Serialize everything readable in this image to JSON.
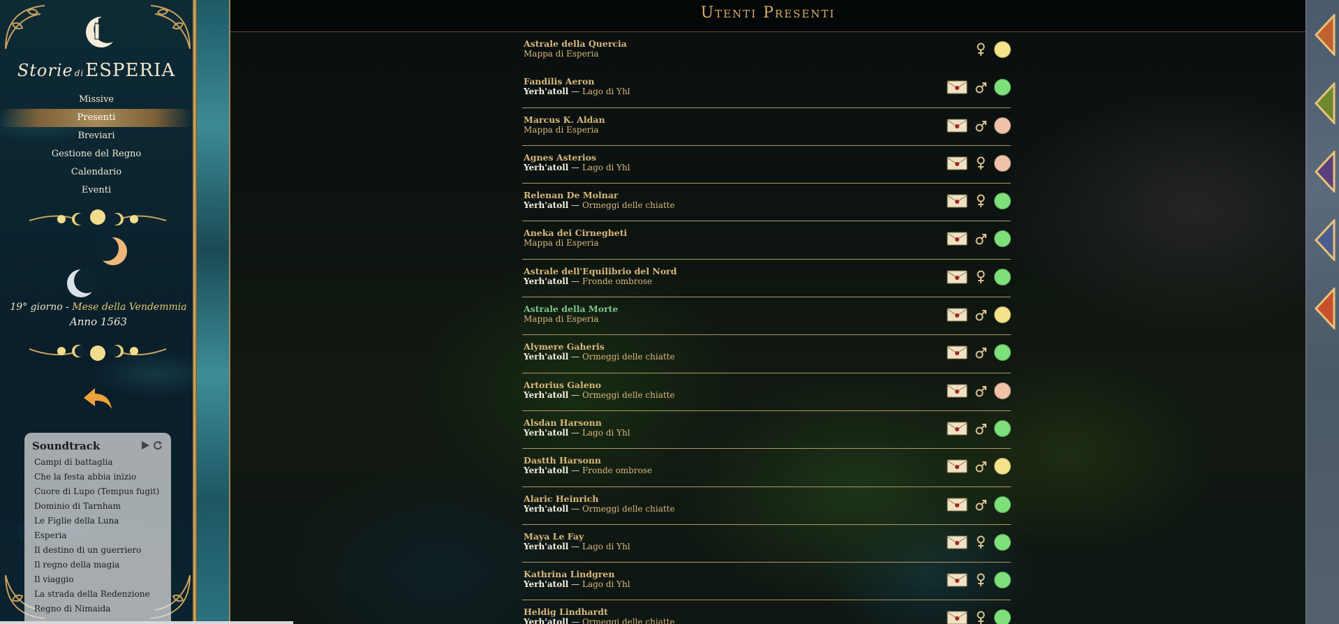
{
  "sidebar": {
    "title_prefix": "Storie",
    "title_di": "di",
    "title_main": "ESPERIA",
    "menu": [
      {
        "label": "Missive",
        "active": false
      },
      {
        "label": "Presenti",
        "active": true
      },
      {
        "label": "Breviari",
        "active": false
      },
      {
        "label": "Gestione del Regno",
        "active": false
      },
      {
        "label": "Calendario",
        "active": false
      },
      {
        "label": "Eventi",
        "active": false
      }
    ],
    "date_day": "19° giorno - ",
    "date_month": "Mese della Vendemmia",
    "date_year": "Anno 1563",
    "soundtrack": {
      "title": "Soundtrack",
      "tracks": [
        "Campi di battaglia",
        "Che la festa abbia inizio",
        "Cuore di Lupo (Tempus fugit)",
        "Dominio di Tarnham",
        "Le Figlie della Luna",
        "Esperia",
        "Il destino di un guerriero",
        "Il regno della magia",
        "Il viaggio",
        "La strada della Redenzione",
        "Regno di Nimaida"
      ]
    }
  },
  "main": {
    "title": "Utenti Presenti",
    "users": [
      {
        "name": "Astrale della Quercia",
        "region": "",
        "place": "Mappa di Esperia",
        "mail": false,
        "gender": "female",
        "status": "#f3e38a",
        "name_color": "gold"
      },
      {
        "name": "Fandilis Aeron",
        "region": "Yerh'atoll",
        "place": "Lago di Yhl",
        "mail": true,
        "gender": "male",
        "status": "#7ee07b",
        "name_color": "gold"
      },
      {
        "name": "Marcus K. Aldan",
        "region": "",
        "place": "Mappa di Esperia",
        "mail": true,
        "gender": "male",
        "status": "#f0c2aa",
        "name_color": "gold"
      },
      {
        "name": "Agnes Asterios",
        "region": "Yerh'atoll",
        "place": "Lago di Yhl",
        "mail": true,
        "gender": "female",
        "status": "#f0c2aa",
        "name_color": "gold"
      },
      {
        "name": "Relenan De Molnar",
        "region": "Yerh'atoll",
        "place": "Ormeggi delle chiatte",
        "mail": true,
        "gender": "female",
        "status": "#7ee07b",
        "name_color": "gold"
      },
      {
        "name": "Aneka dei Cirnegheti",
        "region": "",
        "place": "Mappa di Esperia",
        "mail": true,
        "gender": "male",
        "status": "#7ee07b",
        "name_color": "gold"
      },
      {
        "name": "Astrale dell'Equilibrio del Nord",
        "region": "Yerh'atoll",
        "place": "Fronde ombrose",
        "mail": true,
        "gender": "female",
        "status": "#7ee07b",
        "name_color": "gold"
      },
      {
        "name": "Astrale della Morte",
        "region": "",
        "place": "Mappa di Esperia",
        "mail": true,
        "gender": "male",
        "status": "#f3e38a",
        "name_color": "green"
      },
      {
        "name": "Alymere Gaheris",
        "region": "Yerh'atoll",
        "place": "Ormeggi delle chiatte",
        "mail": true,
        "gender": "male",
        "status": "#7ee07b",
        "name_color": "gold"
      },
      {
        "name": "Artorius Galeno",
        "region": "Yerh'atoll",
        "place": "Ormeggi delle chiatte",
        "mail": true,
        "gender": "male",
        "status": "#f0c2aa",
        "name_color": "gold"
      },
      {
        "name": "Alsdan Harsonn",
        "region": "Yerh'atoll",
        "place": "Lago di Yhl",
        "mail": true,
        "gender": "male",
        "status": "#7ee07b",
        "name_color": "gold"
      },
      {
        "name": "Dastth Harsonn",
        "region": "Yerh'atoll",
        "place": "Fronde ombrose",
        "mail": true,
        "gender": "male",
        "status": "#f3e38a",
        "name_color": "gold"
      },
      {
        "name": "Alaric Heinrich",
        "region": "Yerh'atoll",
        "place": "Ormeggi delle chiatte",
        "mail": true,
        "gender": "male",
        "status": "#7ee07b",
        "name_color": "gold"
      },
      {
        "name": "Maya Le Fay",
        "region": "Yerh'atoll",
        "place": "Lago di Yhl",
        "mail": true,
        "gender": "female",
        "status": "#7ee07b",
        "name_color": "gold"
      },
      {
        "name": "Kathrina Lindgren",
        "region": "Yerh'atoll",
        "place": "Lago di Yhl",
        "mail": true,
        "gender": "female",
        "status": "#7ee07b",
        "name_color": "gold"
      },
      {
        "name": "Heldig Lindhardt",
        "region": "Yerh'atoll",
        "place": "Ormeggi delle chiatte",
        "mail": true,
        "gender": "female",
        "status": "#7ee07b",
        "name_color": "gold"
      }
    ]
  },
  "right_tabs": [
    {
      "color": "#c0622d",
      "icon": "tab-icon"
    },
    {
      "color": "#6f8a2c",
      "icon": "tab-icon"
    },
    {
      "color": "#5a3f7d",
      "icon": "tab-icon"
    },
    {
      "color": "#4a5f8e",
      "icon": "tab-icon"
    },
    {
      "color": "#c9502d",
      "icon": "tab-icon"
    }
  ],
  "colors": {
    "gold": "#d9b77a",
    "green_name": "#7fc28a",
    "divider": "#b09866",
    "status_online": "#7ee07b",
    "status_away": "#f3e38a",
    "status_busy": "#f0c2aa"
  }
}
